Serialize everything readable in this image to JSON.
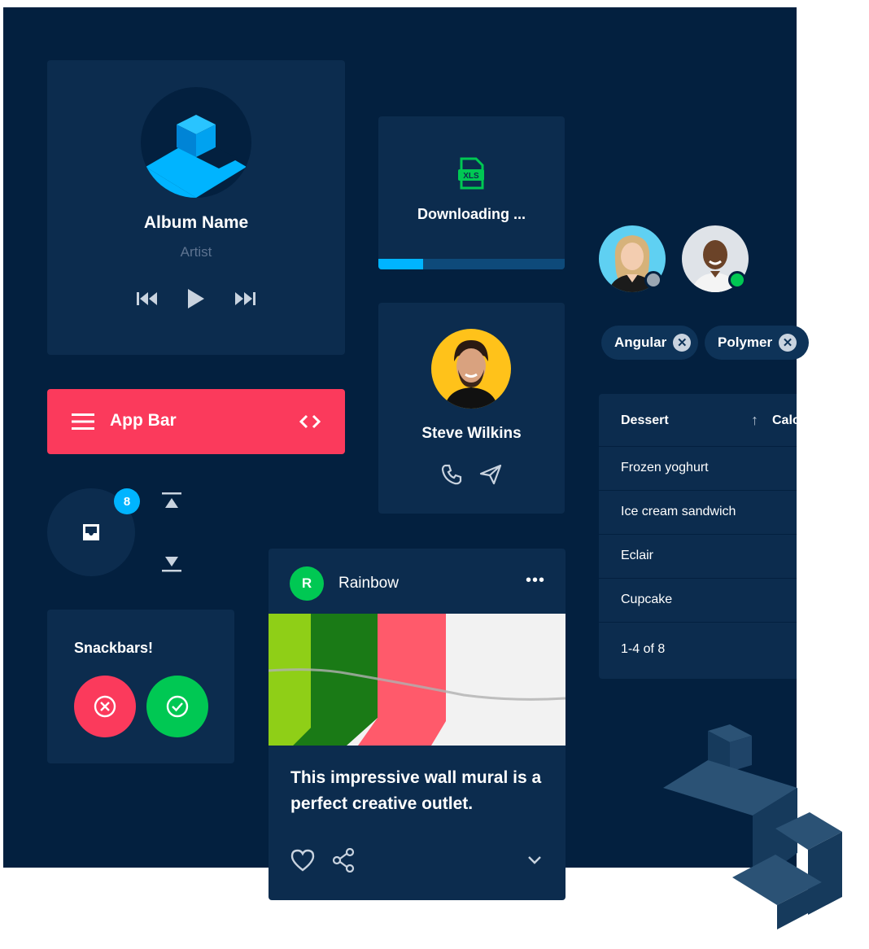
{
  "music": {
    "title": "Album Name",
    "artist": "Artist"
  },
  "download": {
    "label": "Downloading ...",
    "file_type": "XLS",
    "progress": 0.24
  },
  "avatars": [
    {
      "status_color": "#9aa6b2",
      "icon": "avatar-female"
    },
    {
      "status_color": "#00c853",
      "icon": "avatar-male"
    }
  ],
  "chips": [
    {
      "label": "Angular"
    },
    {
      "label": "Polymer"
    }
  ],
  "app_bar": {
    "title": "App Bar"
  },
  "contact": {
    "name": "Steve Wilkins"
  },
  "table": {
    "headers": [
      "Dessert",
      "Calo"
    ],
    "rows": [
      "Frozen yoghurt",
      "Ice cream sandwich",
      "Eclair",
      "Cupcake"
    ],
    "pagination": "1-4 of 8"
  },
  "fab": {
    "badge": "8"
  },
  "snackbars": {
    "title": "Snackbars!"
  },
  "post": {
    "avatar_letter": "R",
    "user": "Rainbow",
    "text": "This impressive wall mural is a perfect creative outlet."
  },
  "colors": {
    "background": "#03203f",
    "card": "#0c2c4e",
    "accent": "#00b4ff",
    "appbar": "#fb3a5c",
    "success": "#00c853"
  }
}
